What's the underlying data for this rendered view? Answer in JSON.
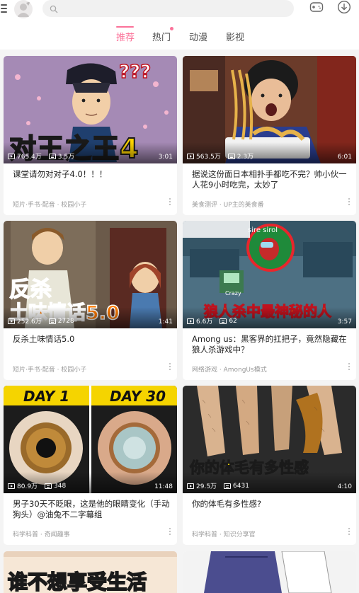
{
  "header": {
    "search_placeholder": "",
    "icons": [
      "menu-icon",
      "avatar",
      "search-icon",
      "game-icon",
      "download-icon"
    ]
  },
  "tabs": [
    {
      "label": "推荐",
      "active": true
    },
    {
      "label": "热门",
      "active": false,
      "has_dot": true
    },
    {
      "label": "动漫",
      "active": false
    },
    {
      "label": "影视",
      "active": false
    }
  ],
  "colors": {
    "accent": "#fb7299",
    "meta": "#9a9a9a"
  },
  "cards": [
    {
      "views": "765.4万",
      "danmaku": "3.5万",
      "duration": "3:01",
      "title": "课堂请勿对对子4.0！！！",
      "meta": "短片·手书·配音 · 校园小子",
      "thumb_text": [
        "对王之王4",
        "???"
      ]
    },
    {
      "views": "563.5万",
      "danmaku": "2.3万",
      "duration": "6:01",
      "title": "据说这份面日本相扑手都吃不完？帅小伙一人花9小时吃完，太妙了",
      "meta": "美食测评 · UP主的美食番",
      "thumb_text": []
    },
    {
      "views": "252.6万",
      "danmaku": "2728",
      "duration": "1:41",
      "title": "反杀土味情话5.0",
      "meta": "短片·手书·配音 · 校园小子",
      "thumb_text": [
        "反杀",
        "土味情话5.0"
      ]
    },
    {
      "views": "6.6万",
      "danmaku": "62",
      "duration": "3:57",
      "title": "Among us：黑客界的扛把子，竟然隐藏在狼人杀游戏中？",
      "meta": "网络游戏 · AmongUs模式",
      "thumb_text": [
        "狼人杀中最神秘的人",
        "sire sirol",
        "Crazy"
      ]
    },
    {
      "views": "80.9万",
      "danmaku": "348",
      "duration": "11:48",
      "title": "男子30天不眨眼，这是他的眼睛变化（手动狗头）@油兔不二字幕组",
      "meta": "科学科普 · 奇闻趣事",
      "thumb_text": [
        "DAY 1",
        "DAY 30"
      ]
    },
    {
      "views": "29.5万",
      "danmaku": "6431",
      "duration": "4:10",
      "title": "你的体毛有多性感?",
      "meta": "科学科普 · 知识分享官",
      "thumb_text": [
        "你的体毛有多性感"
      ]
    },
    {
      "thumb_text": [
        "谁不想享受生活"
      ]
    }
  ]
}
